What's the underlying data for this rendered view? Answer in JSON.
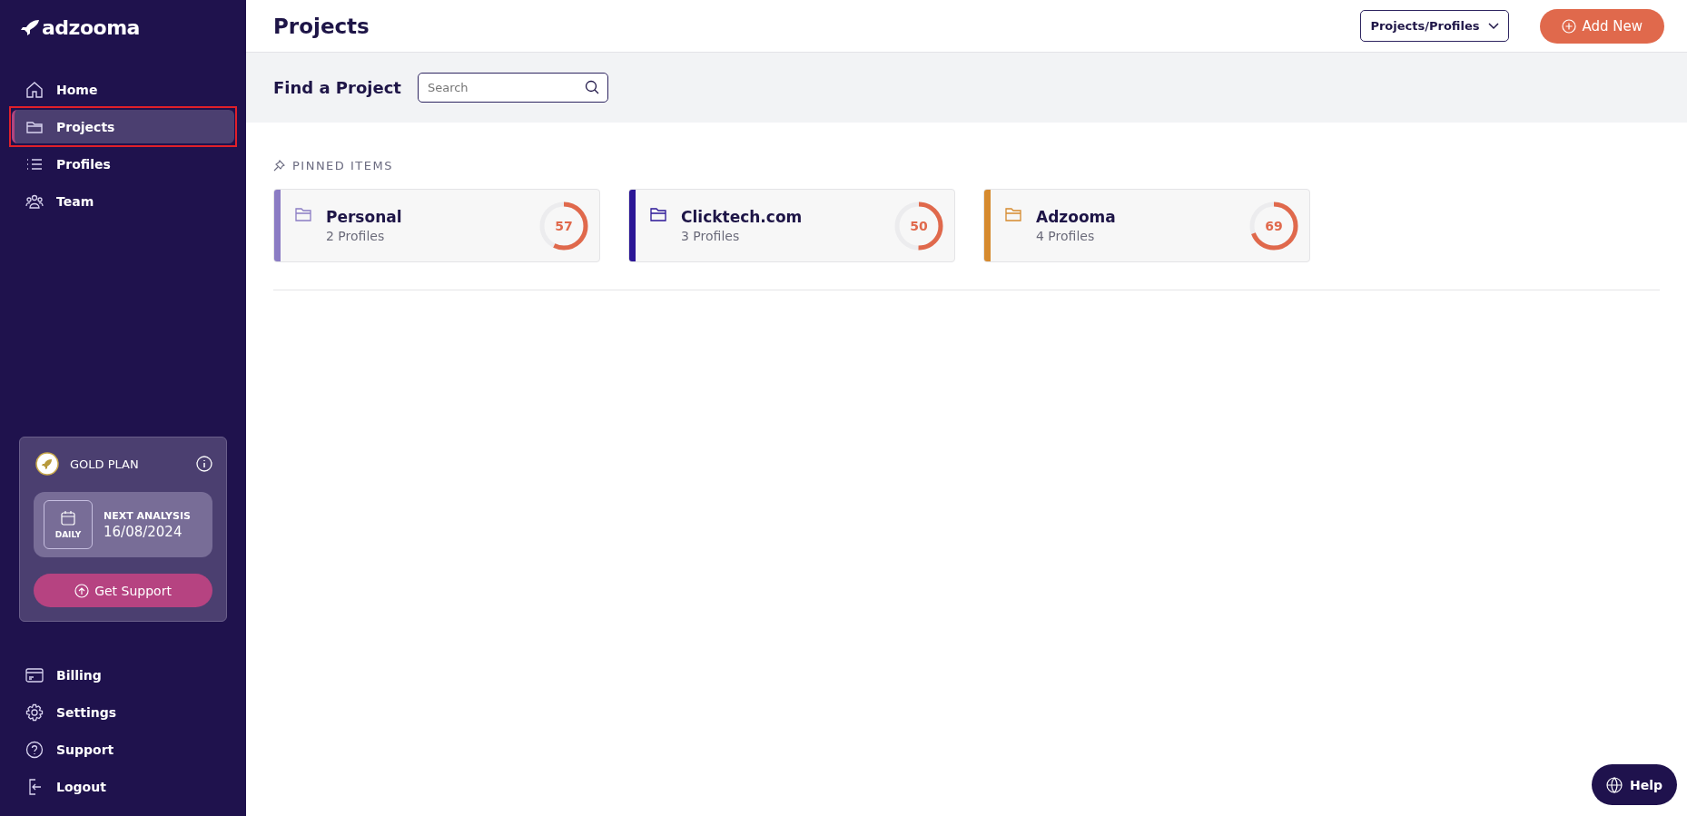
{
  "sidebar": {
    "logo": "adzooma",
    "nav": [
      {
        "label": "Home",
        "selected": false,
        "annotated": false
      },
      {
        "label": "Projects",
        "selected": true,
        "annotated": true
      },
      {
        "label": "Profiles",
        "selected": false,
        "annotated": false
      },
      {
        "label": "Team",
        "selected": false,
        "annotated": false
      }
    ],
    "plan": {
      "name": "GOLD PLAN",
      "schedule": "DAILY",
      "next_label": "NEXT ANALYSIS",
      "next_date": "16/08/2024",
      "button": "Get Support"
    },
    "bottom_nav": [
      {
        "label": "Billing"
      },
      {
        "label": "Settings"
      },
      {
        "label": "Support"
      },
      {
        "label": "Logout"
      }
    ]
  },
  "header": {
    "title": "Projects",
    "dropdown": "Projects/Profiles",
    "add_button": "Add New"
  },
  "search_bar": {
    "label": "Find a Project",
    "placeholder": "Search"
  },
  "pinned": {
    "heading": "PINNED ITEMS",
    "items": [
      {
        "name": "Personal",
        "profiles": "2 Profiles",
        "score": "57",
        "level": 0.57,
        "color": "#8b7cc4"
      },
      {
        "name": "Clicktech.com",
        "profiles": "3 Profiles",
        "score": "50",
        "level": 0.5,
        "color": "#2b1696"
      },
      {
        "name": "Adzooma",
        "profiles": "4 Profiles",
        "score": "69",
        "level": 0.69,
        "color": "#d68a2e"
      }
    ]
  },
  "help_button": "Help"
}
